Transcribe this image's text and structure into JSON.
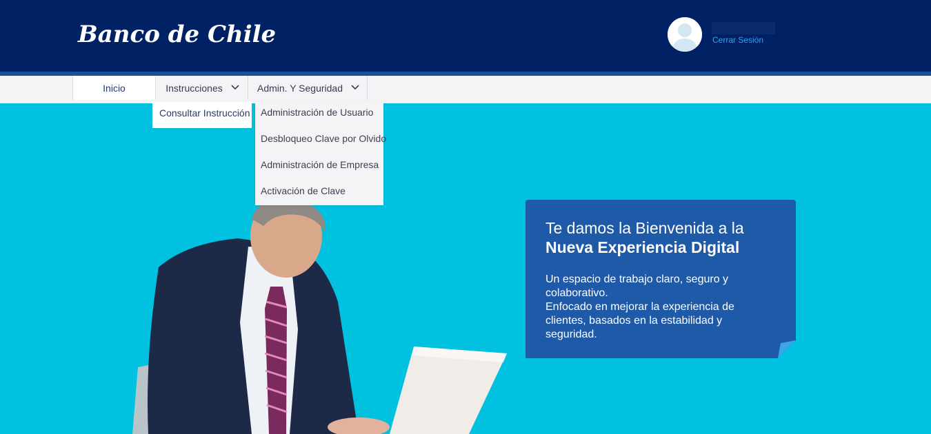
{
  "header": {
    "logo_text": "Banco de Chile",
    "user_name": "",
    "logout_label": "Cerrar Sesión",
    "avatar_icon": "user-avatar-icon"
  },
  "nav": {
    "items": [
      {
        "label": "Inicio"
      },
      {
        "label": "Instrucciones",
        "icon": "chevron-down-icon"
      },
      {
        "label": "Admin. Y Seguridad",
        "icon": "chevron-down-icon"
      }
    ]
  },
  "dropdown_instrucciones": {
    "items": [
      "Consultar Instrucción"
    ]
  },
  "dropdown_admin": {
    "items": [
      "Administración de Usuario",
      "Desbloqueo Clave por Olvido",
      "Administración de Empresa",
      "Activación de Clave"
    ]
  },
  "hero": {
    "title_line1": "Te damos la Bienvenida a la",
    "title_line2": "Nueva Experiencia Digital",
    "body_line1": "Un espacio de trabajo claro, seguro y",
    "body_line2": "colaborativo.",
    "body_line3": "Enfocado en mejorar la experiencia de",
    "body_line4": "clientes, basados en la estabilidad y",
    "body_line5": "seguridad."
  },
  "colors": {
    "header_bg": "#002163",
    "hero_bg": "#00c2e0",
    "card_bg": "#1f5aa8",
    "link": "#2ea3f2"
  }
}
